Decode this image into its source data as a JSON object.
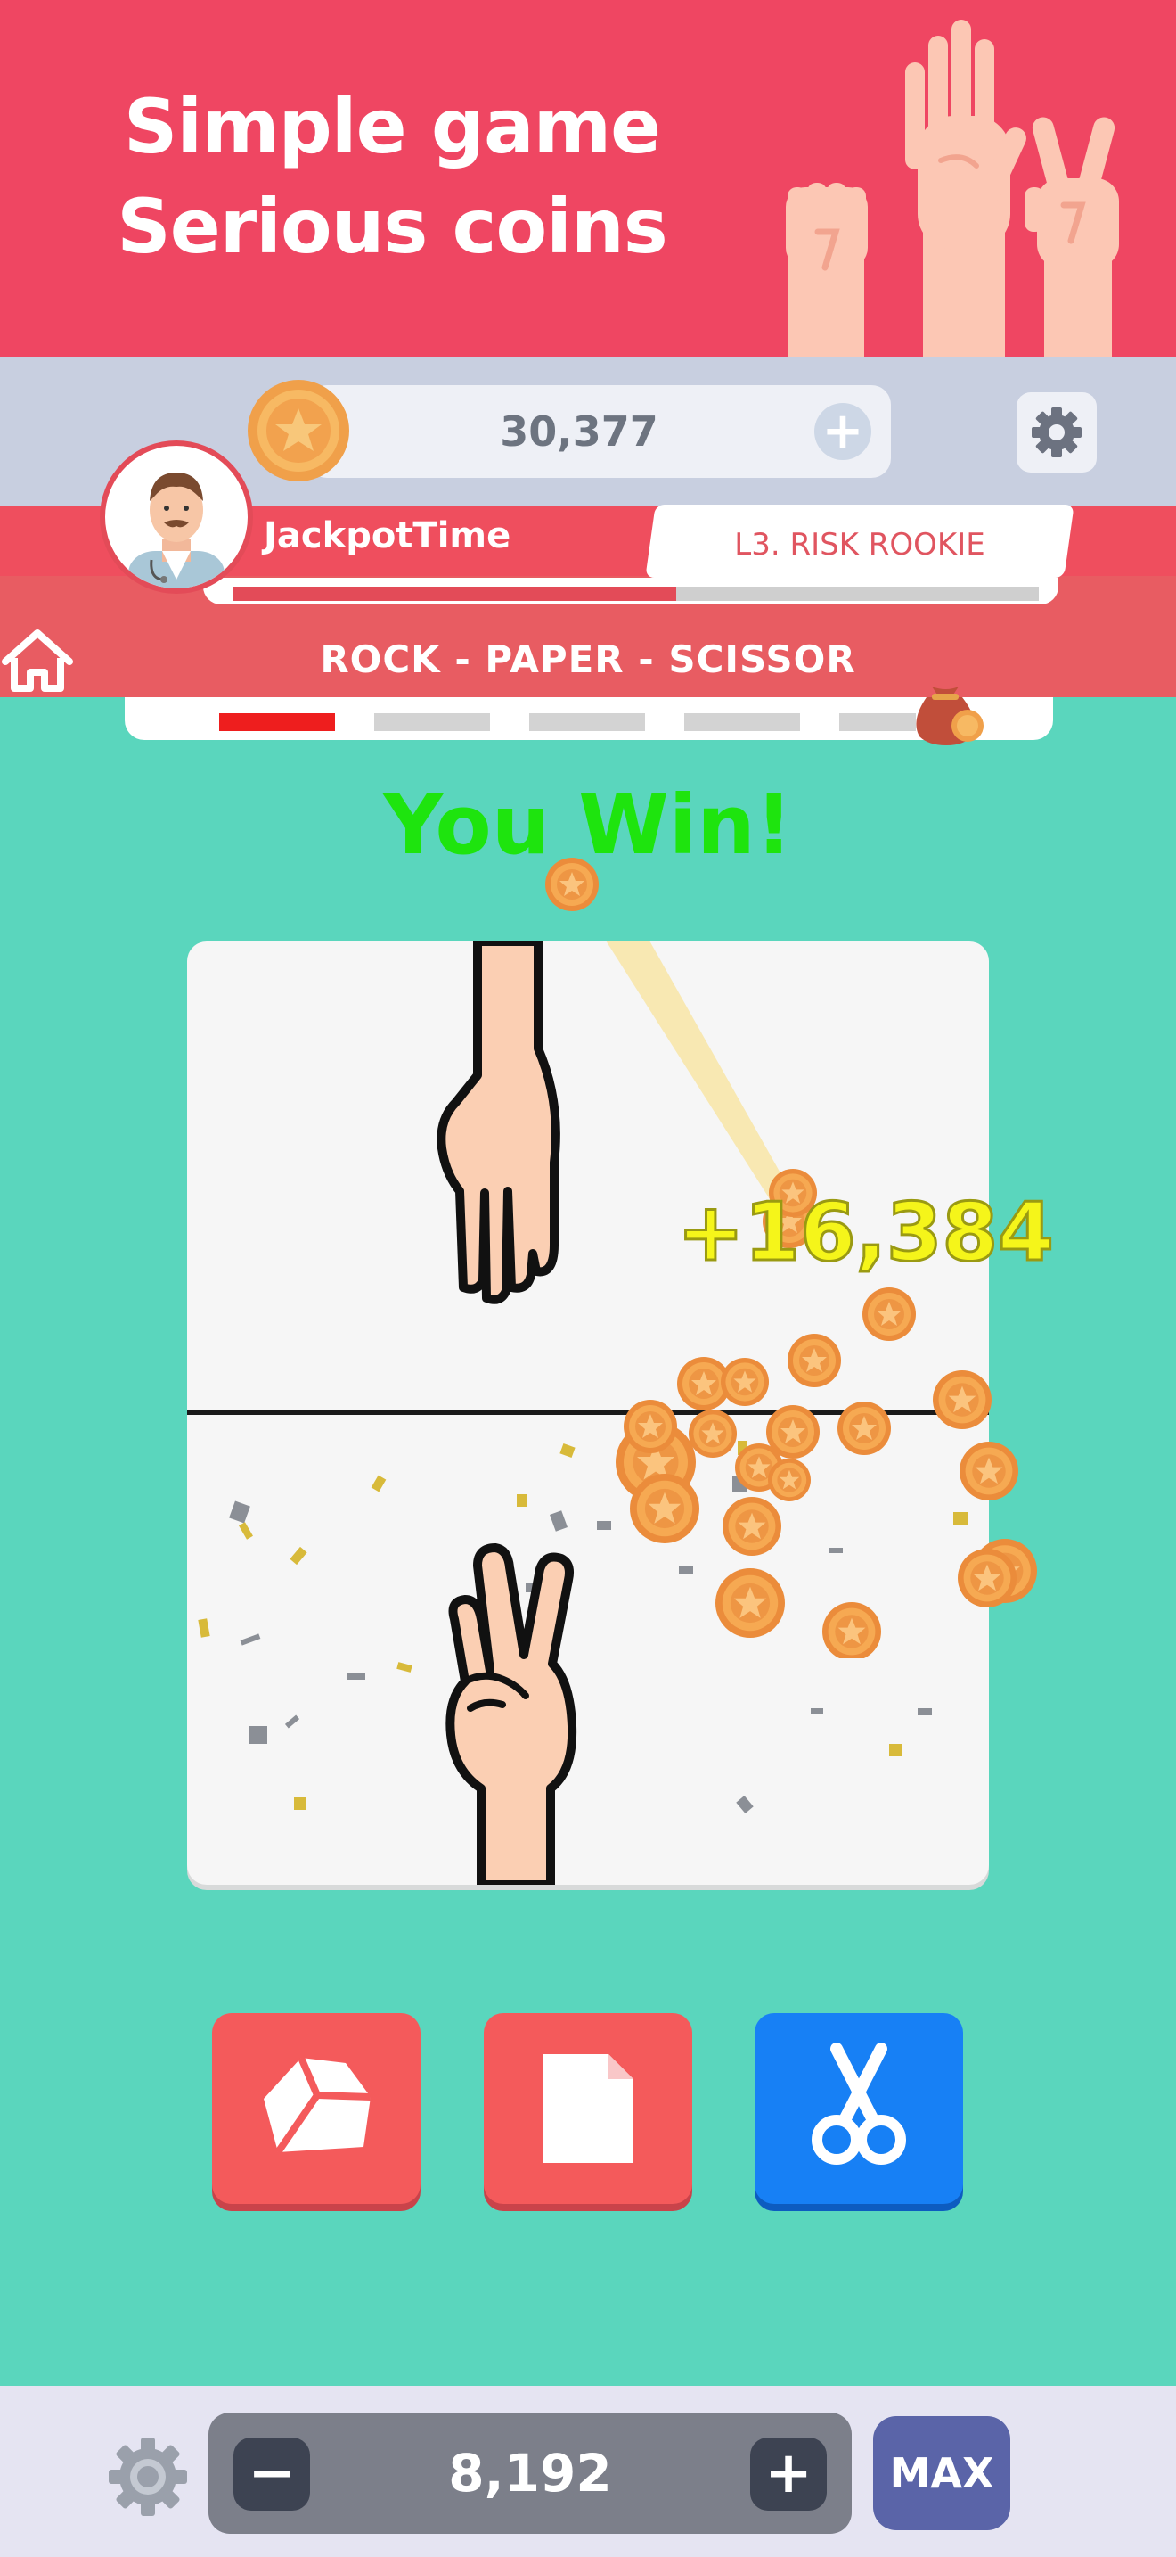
{
  "banner": {
    "line1": "Simple game",
    "line2": "Serious coins",
    "background_color": "#ef4662"
  },
  "wallet": {
    "balance": "30,377",
    "add_label": "+"
  },
  "player": {
    "name": "JackpotTime",
    "rank": "L3. RISK ROOKIE",
    "level_progress_fraction": 0.55
  },
  "game": {
    "title": "ROCK - PAPER - SCISSOR",
    "rounds_total": 5,
    "rounds_active": 1,
    "result": "You Win!",
    "win_amount": "+16,384",
    "opponent_choice": "paper",
    "player_choice": "scissor"
  },
  "choices": [
    {
      "name": "rock",
      "icon": "rock-icon",
      "color": "#f45a5b"
    },
    {
      "name": "paper",
      "icon": "paper-icon",
      "color": "#f45a5b"
    },
    {
      "name": "scissor",
      "icon": "scissors-icon",
      "color": "#1780f5",
      "selected": true
    }
  ],
  "bet": {
    "value": "8,192",
    "minus_label": "−",
    "plus_label": "+",
    "max_label": "MAX"
  },
  "colors": {
    "board_background": "#5ad6bd",
    "result": "#1ee40e",
    "win_amount": "#f5f51a"
  }
}
